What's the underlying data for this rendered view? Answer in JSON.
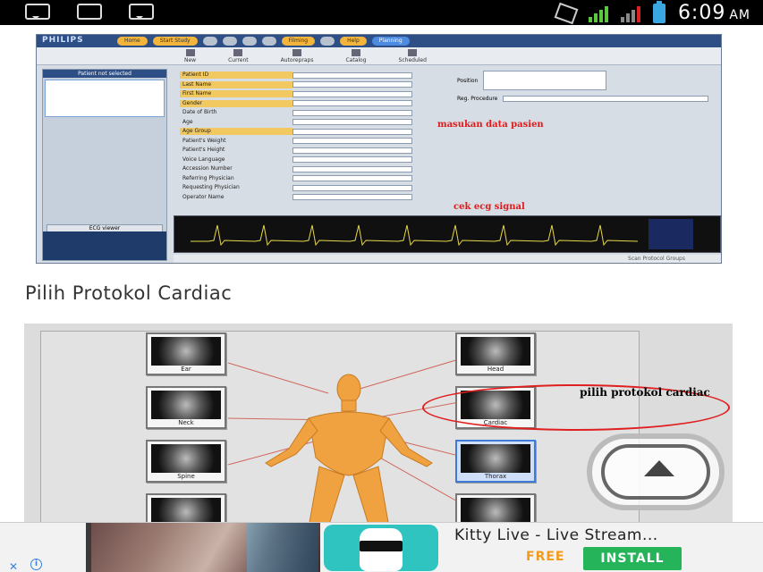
{
  "status_bar": {
    "time": "6:09",
    "ampm": "AM"
  },
  "philips_screen": {
    "brand": "PHILIPS",
    "top_tabs": [
      "Home",
      "Start Study",
      "",
      "",
      "",
      "",
      "Filming",
      "",
      "Help",
      "Planning"
    ],
    "toolbar": [
      "New",
      "Current",
      "Autorepraps",
      "Catalog",
      "Scheduled"
    ],
    "left_panel_title": "Patient not selected",
    "ecg_viewer_label": "ECG viewer",
    "fields": [
      {
        "label": "Patient ID",
        "highlight": true
      },
      {
        "label": "Last Name",
        "highlight": true
      },
      {
        "label": "First Name",
        "highlight": true
      },
      {
        "label": "Gender",
        "highlight": true
      },
      {
        "label": "Date of Birth",
        "highlight": false
      },
      {
        "label": "Age",
        "highlight": false
      },
      {
        "label": "Age Group",
        "highlight": true
      },
      {
        "label": "Patient's Weight",
        "highlight": false
      },
      {
        "label": "Patient's Height",
        "highlight": false
      },
      {
        "label": "Voice Language",
        "highlight": false
      },
      {
        "label": "Accession Number",
        "highlight": false
      },
      {
        "label": "Referring Physician",
        "highlight": false
      },
      {
        "label": "Requesting Physician",
        "highlight": false
      },
      {
        "label": "Operator Name",
        "highlight": false
      }
    ],
    "position_label": "Position",
    "reg_procedure_label": "Reg. Procedure",
    "bottom_text": "Scan Protocol Groups",
    "annotation_1": "masukan data pasien",
    "annotation_2": "cek ecg signal"
  },
  "heading": "Pilih Protokol Cardiac",
  "protocol_screen": {
    "left_thumbs": [
      "Ear",
      "Neck",
      "Spine",
      ""
    ],
    "right_thumbs": [
      "Head",
      "Cardiac",
      "Thorax",
      ""
    ],
    "selected": "Thorax",
    "annotation": "pilih protokol cardiac"
  },
  "ad": {
    "title": "Kitty Live - Live Stream...",
    "price": "FREE",
    "install_label": "INSTALL",
    "close_glyph": "✕",
    "info_glyph": "i"
  },
  "colors": {
    "accent_green": "#25b45a",
    "accent_orange": "#f29a1a",
    "annotation_red": "#e01a1a"
  }
}
